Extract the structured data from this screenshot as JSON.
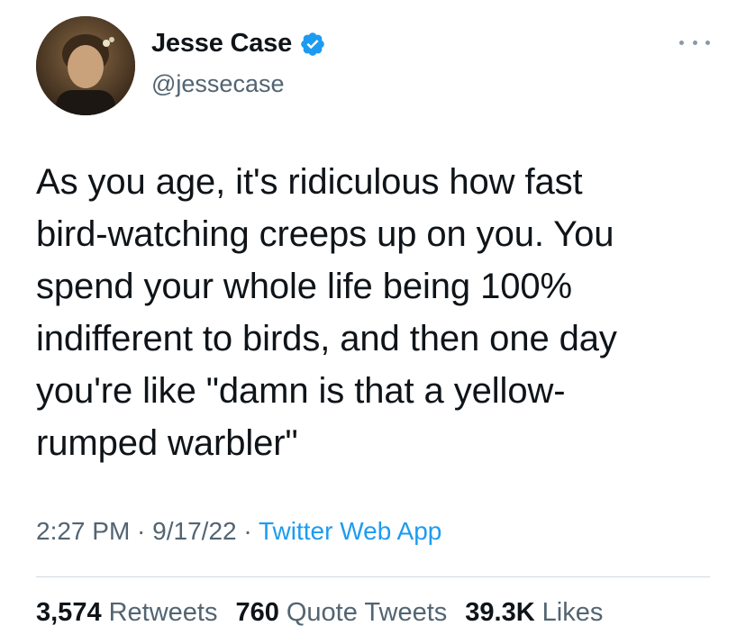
{
  "author": {
    "display_name": "Jesse Case",
    "handle": "@jessecase",
    "verified": true,
    "verified_color": "#1d9bf0"
  },
  "tweet": {
    "text": "As you age, it's ridiculous how fast\nbird-watching creeps up on you. You\nspend your whole life being 100%\nindifferent to birds, and then one day\nyou're like \"damn is that a yellow-\nrumped warbler\"",
    "time": "2:27 PM",
    "date": "9/17/22",
    "source": "Twitter Web App",
    "separator": " · "
  },
  "stats": {
    "retweets_count": "3,574",
    "retweets_label": "Retweets",
    "quote_count": "760",
    "quote_label": "Quote Tweets",
    "likes_count": "39.3K",
    "likes_label": "Likes"
  },
  "icons": {
    "verified": "verified-badge-icon",
    "more": "more-options-icon"
  },
  "colors": {
    "text_primary": "#0f1419",
    "text_secondary": "#536471",
    "link": "#1d9bf0"
  }
}
